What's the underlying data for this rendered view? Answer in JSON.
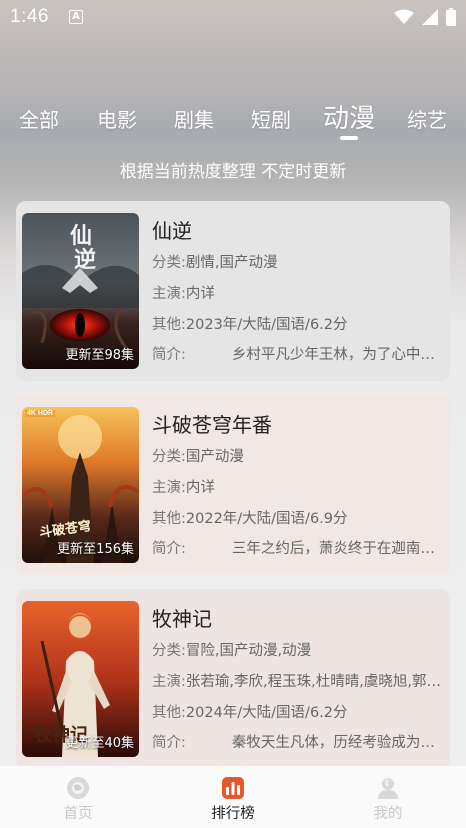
{
  "status_bar": {
    "time": "1:46",
    "notification_icon": "a-icon",
    "icons": [
      "wifi-icon",
      "signal-icon",
      "battery-icon"
    ]
  },
  "tabs": [
    {
      "label": "全部",
      "active": false
    },
    {
      "label": "电影",
      "active": false
    },
    {
      "label": "剧集",
      "active": false
    },
    {
      "label": "短剧",
      "active": false
    },
    {
      "label": "动漫",
      "active": true
    },
    {
      "label": "综艺",
      "active": false
    }
  ],
  "subtitle": "根据当前热度整理 不定时更新",
  "cards": [
    {
      "title": "仙逆",
      "badge": "更新至98集",
      "category_label": "分类:",
      "category": "剧情,国产动漫",
      "cast_label": "主演:",
      "cast": "内详",
      "other_label": "其他:",
      "other": "2023年/大陆/国语/6.2分",
      "intro_label": "简介:",
      "intro": "乡村平凡少年王林，为了心中的梦想走上修仙之路"
    },
    {
      "title": "斗破苍穹年番",
      "badge": "更新至156集",
      "poster_tag": "4K HDR",
      "category_label": "分类:",
      "category": "国产动漫",
      "cast_label": "主演:",
      "cast": "内详",
      "other_label": "其他:",
      "other": "2022年/大陆/国语/6.9分",
      "intro_label": "简介:",
      "intro": "三年之约后，萧炎终于在迦南学院见到了心心念念的"
    },
    {
      "title": "牧神记",
      "badge": "更新至40集",
      "category_label": "分类:",
      "category": "冒险,国产动漫,动漫",
      "cast_label": "主演:",
      "cast": "张若瑜,李欣,程玉珠,杜晴晴,虞晓旭,郭浩然",
      "other_label": "其他:",
      "other": "2024年/大陆/国语/6.2分",
      "intro_label": "简介:",
      "intro": "秦牧天生凡体，历经考验成为一代人皇"
    }
  ],
  "bottom_nav": [
    {
      "label": "首页",
      "icon": "home-icon",
      "active": false
    },
    {
      "label": "排行榜",
      "icon": "ranking-icon",
      "active": true
    },
    {
      "label": "我的",
      "icon": "profile-icon",
      "active": false
    }
  ],
  "colors": {
    "accent": "#e8572b",
    "card1_bg": "#e7e6e7",
    "card2_bg": "#f1e7e3",
    "card3_bg": "#efe5e3"
  }
}
